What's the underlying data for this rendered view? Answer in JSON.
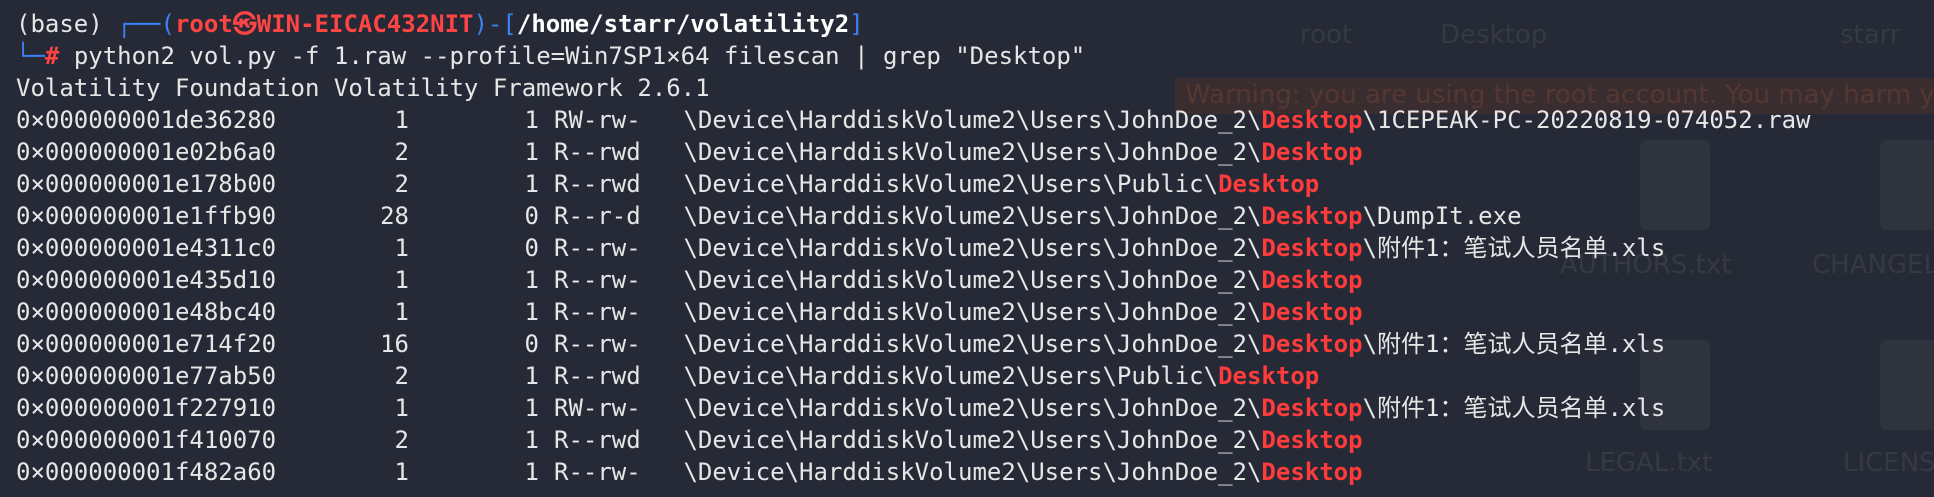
{
  "prompt": {
    "env": "(base)",
    "corner_top": "┌──",
    "user_host": "root㉿WIN-EICAC432NIT",
    "path": "/home/starr/volatility2",
    "corner_bottom": "└─",
    "hash": "#",
    "command": "python2 vol.py -f 1.raw --profile=Win7SP1×64 filescan | grep \"Desktop\""
  },
  "banner": "Volatility Foundation Volatility Framework 2.6.1",
  "highlight": "Desktop",
  "rows": [
    {
      "offset": "0×000000001de36280",
      "ptr": "1",
      "hnd": "1",
      "access": "RW-rw-",
      "pre": "\\Device\\HarddiskVolume2\\Users\\JohnDoe_2\\",
      "post": "\\1CEPEAK-PC-20220819-074052.raw"
    },
    {
      "offset": "0×000000001e02b6a0",
      "ptr": "2",
      "hnd": "1",
      "access": "R--rwd",
      "pre": "\\Device\\HarddiskVolume2\\Users\\JohnDoe_2\\",
      "post": ""
    },
    {
      "offset": "0×000000001e178b00",
      "ptr": "2",
      "hnd": "1",
      "access": "R--rwd",
      "pre": "\\Device\\HarddiskVolume2\\Users\\Public\\",
      "post": ""
    },
    {
      "offset": "0×000000001e1ffb90",
      "ptr": "28",
      "hnd": "0",
      "access": "R--r-d",
      "pre": "\\Device\\HarddiskVolume2\\Users\\JohnDoe_2\\",
      "post": "\\DumpIt.exe"
    },
    {
      "offset": "0×000000001e4311c0",
      "ptr": "1",
      "hnd": "0",
      "access": "R--rw-",
      "pre": "\\Device\\HarddiskVolume2\\Users\\JohnDoe_2\\",
      "post": "\\附件1：笔试人员名单.xls"
    },
    {
      "offset": "0×000000001e435d10",
      "ptr": "1",
      "hnd": "1",
      "access": "R--rw-",
      "pre": "\\Device\\HarddiskVolume2\\Users\\JohnDoe_2\\",
      "post": ""
    },
    {
      "offset": "0×000000001e48bc40",
      "ptr": "1",
      "hnd": "1",
      "access": "R--rw-",
      "pre": "\\Device\\HarddiskVolume2\\Users\\JohnDoe_2\\",
      "post": ""
    },
    {
      "offset": "0×000000001e714f20",
      "ptr": "16",
      "hnd": "0",
      "access": "R--rw-",
      "pre": "\\Device\\HarddiskVolume2\\Users\\JohnDoe_2\\",
      "post": "\\附件1：笔试人员名单.xls"
    },
    {
      "offset": "0×000000001e77ab50",
      "ptr": "2",
      "hnd": "1",
      "access": "R--rwd",
      "pre": "\\Device\\HarddiskVolume2\\Users\\Public\\",
      "post": ""
    },
    {
      "offset": "0×000000001f227910",
      "ptr": "1",
      "hnd": "1",
      "access": "RW-rw-",
      "pre": "\\Device\\HarddiskVolume2\\Users\\JohnDoe_2\\",
      "post": "\\附件1：笔试人员名单.xls"
    },
    {
      "offset": "0×000000001f410070",
      "ptr": "2",
      "hnd": "1",
      "access": "R--rwd",
      "pre": "\\Device\\HarddiskVolume2\\Users\\JohnDoe_2\\",
      "post": ""
    },
    {
      "offset": "0×000000001f482a60",
      "ptr": "1",
      "hnd": "1",
      "access": "R--rw-",
      "pre": "\\Device\\HarddiskVolume2\\Users\\JohnDoe_2\\",
      "post": ""
    }
  ],
  "background": {
    "breadcrumb": [
      "root",
      "Desktop",
      "starr"
    ],
    "warning": "Warning: you are using the root account. You may harm your",
    "files": [
      "AUTHORS.txt",
      "CHANGELOG",
      "LEGAL.txt",
      "LICENSE"
    ]
  },
  "colors": {
    "background": "#262a36",
    "prompt_user": "#ff4444",
    "prompt_bracket": "#3b82f6",
    "highlight": "#ff3b3b",
    "text": "#e6e6e6"
  }
}
